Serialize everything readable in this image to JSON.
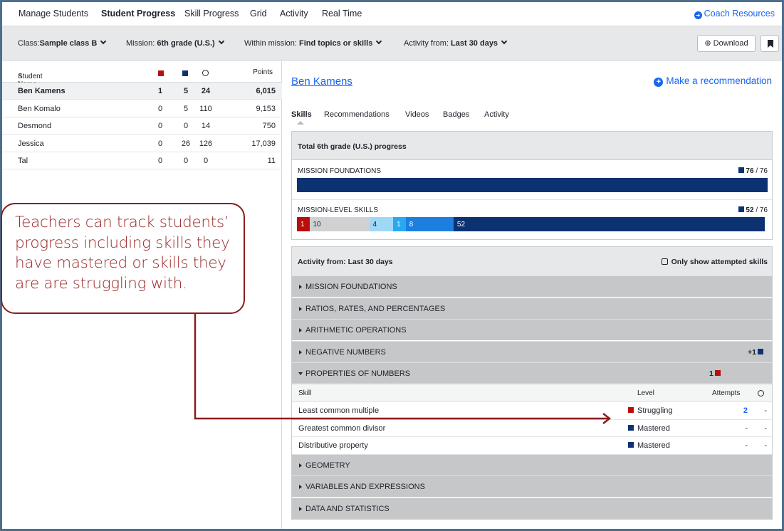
{
  "topnav": {
    "tabs": [
      "Manage Students",
      "Student Progress",
      "Skill Progress",
      "Grid",
      "Activity",
      "Real Time"
    ],
    "coach_resources": "Coach Resources"
  },
  "filters": {
    "class_label": "Class:",
    "class_value": "Sample class B",
    "mission_label": "Mission:",
    "mission_value": "6th grade (U.S.)",
    "within_label": "Within mission:",
    "within_value": "Find topics or skills",
    "activity_label": "Activity from:",
    "activity_value": "Last 30 days",
    "download": "Download"
  },
  "students": {
    "header": {
      "name": "Student Name",
      "points": "Points"
    },
    "rows": [
      {
        "name": "Ben Kamens",
        "struggling": "1",
        "mastered": "5",
        "time": "24",
        "points": "6,015"
      },
      {
        "name": "Ben Komalo",
        "struggling": "0",
        "mastered": "5",
        "time": "110",
        "points": "9,153"
      },
      {
        "name": "Desmond",
        "struggling": "0",
        "mastered": "0",
        "time": "14",
        "points": "750"
      },
      {
        "name": "Jessica",
        "struggling": "0",
        "mastered": "26",
        "time": "126",
        "points": "17,039"
      },
      {
        "name": "Tal",
        "struggling": "0",
        "mastered": "0",
        "time": "0",
        "points": "11"
      }
    ]
  },
  "detail": {
    "student_name": "Ben Kamens",
    "make_recommendation": "Make a recommendation",
    "subtabs": [
      "Skills",
      "Recommendations",
      "Videos",
      "Badges",
      "Activity"
    ],
    "progress_title": "Total 6th grade (U.S.) progress",
    "foundations": {
      "label": "MISSION FOUNDATIONS",
      "count": "76",
      "total": "/ 76"
    },
    "mission_skills": {
      "label": "MISSION-LEVEL SKILLS",
      "count": "52",
      "total": "/ 76",
      "segments": [
        {
          "value": "1",
          "color": "#b80e0e"
        },
        {
          "value": "10",
          "color": "#cfd1d3"
        },
        {
          "value": "4",
          "color": "#9fd8f7"
        },
        {
          "value": "1",
          "color": "#29a8f0"
        },
        {
          "value": "8",
          "color": "#1c7fe0"
        },
        {
          "value": "52",
          "color": "#0c3272"
        }
      ]
    },
    "activity_title": "Activity from: Last 30 days",
    "only_attempted": "Only show attempted skills",
    "topics": [
      {
        "label": "MISSION FOUNDATIONS",
        "badge": ""
      },
      {
        "label": "RATIOS, RATES, AND PERCENTAGES",
        "badge": ""
      },
      {
        "label": "ARITHMETIC OPERATIONS",
        "badge": ""
      },
      {
        "label": "NEGATIVE NUMBERS",
        "badge": "+1"
      },
      {
        "label": "PROPERTIES OF NUMBERS",
        "badge": "1"
      }
    ],
    "skill_header": {
      "skill": "Skill",
      "level": "Level",
      "attempts": "Attempts"
    },
    "skills": [
      {
        "name": "Least common multiple",
        "level": "Struggling",
        "attempts": "2",
        "time": "-"
      },
      {
        "name": "Greatest common divisor",
        "level": "Mastered",
        "attempts": "-",
        "time": "-"
      },
      {
        "name": "Distributive property",
        "level": "Mastered",
        "attempts": "-",
        "time": "-"
      }
    ],
    "topics_after": [
      {
        "label": "GEOMETRY"
      },
      {
        "label": "VARIABLES AND EXPRESSIONS"
      },
      {
        "label": "DATA AND STATISTICS"
      }
    ]
  },
  "callout": {
    "text": "Teachers can track students’ progress including  skills  they have mastered or skills they are are struggling with."
  },
  "colors": {
    "link": "#1865f2",
    "struggling": "#b80e0e",
    "mastered": "#0c3272",
    "callout": "#8b1c1c"
  }
}
